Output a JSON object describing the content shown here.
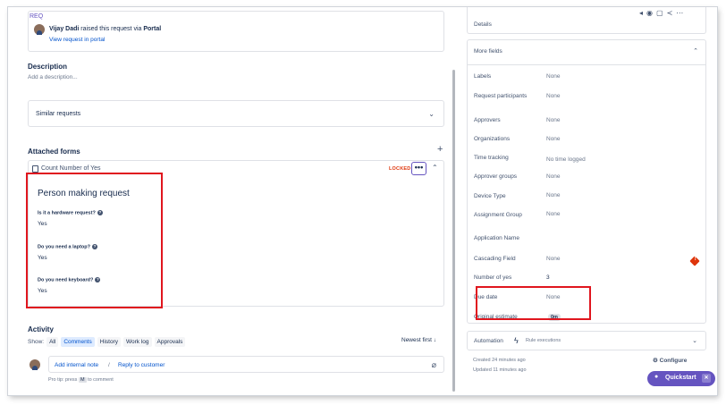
{
  "portal": {
    "top_text": "REQ",
    "requester": "Vijay Dadi",
    "raised_text": "raised this request via",
    "channel": "Portal",
    "view_link": "View request in portal"
  },
  "description": {
    "heading": "Description",
    "placeholder": "Add a description..."
  },
  "similar_requests": {
    "label": "Similar requests"
  },
  "attached_forms": {
    "heading": "Attached forms",
    "form_name": "Count Number of Yes",
    "locked": "LOCKED",
    "form_title": "Person making request",
    "questions": [
      {
        "q": "Is it a hardware request?",
        "a": "Yes"
      },
      {
        "q": "Do you need a laptop?",
        "a": "Yes"
      },
      {
        "q": "Do you need keyboard?",
        "a": "Yes"
      }
    ]
  },
  "activity": {
    "heading": "Activity",
    "show_label": "Show:",
    "filters": [
      "All",
      "Comments",
      "History",
      "Work log",
      "Approvals"
    ],
    "active_filter": "Comments",
    "sort": "Newest first ↓",
    "add_internal_note": "Add internal note",
    "separator": "/",
    "reply_to_customer": "Reply to customer",
    "protip_prefix": "Pro tip: press",
    "protip_key": "M",
    "protip_suffix": "to comment"
  },
  "details": {
    "label": "Details"
  },
  "more_fields": {
    "heading": "More fields",
    "fields": [
      {
        "key": "Labels",
        "value": "None"
      },
      {
        "key": "Request participants",
        "value": "None"
      },
      {
        "key": "Approvers",
        "value": "None"
      },
      {
        "key": "Organizations",
        "value": "None"
      },
      {
        "key": "Time tracking",
        "value": "No time logged"
      },
      {
        "key": "Approver groups",
        "value": "None"
      },
      {
        "key": "Device Type",
        "value": "None"
      },
      {
        "key": "Assignment Group",
        "value": "None"
      },
      {
        "key": "Application Name",
        "value": ""
      },
      {
        "key": "Cascading Field",
        "value": "None"
      },
      {
        "key": "Number of yes",
        "value": "3"
      },
      {
        "key": "Due date",
        "value": "None"
      },
      {
        "key": "Original estimate",
        "value": "0m"
      }
    ]
  },
  "automation": {
    "label": "Automation",
    "rule_executions": "Rule executions"
  },
  "footer": {
    "created": "Created 24 minutes ago",
    "updated": "Updated 11 minutes ago",
    "configure": "Configure",
    "quickstart": "Quickstart"
  },
  "colors": {
    "accent_purple": "#6554c0",
    "link_blue": "#0052cc",
    "highlight_red": "#e0161e",
    "locked_red": "#de350b"
  }
}
